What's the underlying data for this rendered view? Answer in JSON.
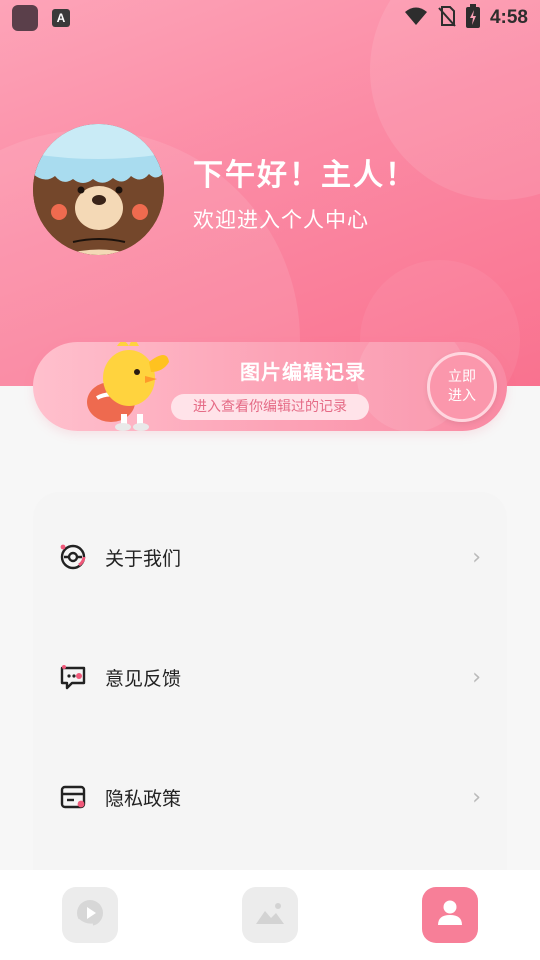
{
  "status_bar": {
    "time": "4:58",
    "icons": [
      "app-icon",
      "a-icon",
      "wifi-icon",
      "no-sim-icon",
      "battery-charging-icon"
    ]
  },
  "profile": {
    "greeting_title": "下午好！主人！",
    "greeting_subtitle": "欢迎进入个人中心",
    "avatar_icon": "bear-avatar-icon"
  },
  "banner": {
    "title": "图片编辑记录",
    "subtitle": "进入查看你编辑过的记录",
    "enter_line1": "立即",
    "enter_line2": "进入",
    "mascot_icon": "chick-mascot-icon"
  },
  "menu": {
    "items": [
      {
        "label": "关于我们",
        "icon": "about-icon"
      },
      {
        "label": "意见反馈",
        "icon": "feedback-icon"
      },
      {
        "label": "隐私政策",
        "icon": "privacy-icon"
      }
    ],
    "chevron": "›"
  },
  "bottom_nav": {
    "items": [
      {
        "icon": "video-icon",
        "active": false
      },
      {
        "icon": "image-icon",
        "active": false
      },
      {
        "icon": "user-icon",
        "active": true
      }
    ]
  },
  "colors": {
    "accent": "#f77f98",
    "header_top": "#fda4b8",
    "header_bottom": "#f9728f",
    "menu_icon_accent": "#f0597a"
  }
}
